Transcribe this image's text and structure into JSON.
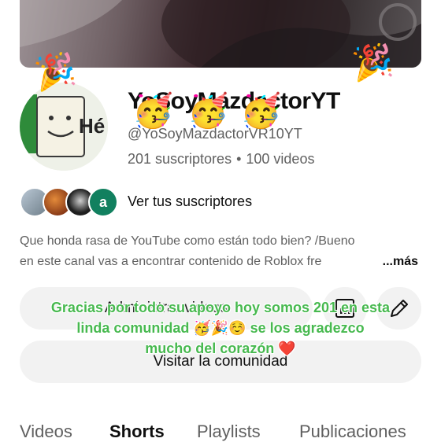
{
  "channel": {
    "name": "YoSoyMazdactorYT",
    "handle": "@YoSoyMazdactorVR10YT",
    "subscribers": "201 suscriptores",
    "videos": "100 videos",
    "avatar_text": "Hé"
  },
  "subscribers_row": {
    "label": "Ver tus suscriptores",
    "last_avatar_letter": "a"
  },
  "description": {
    "line1": "Que honda rasa de YouTube como están todo bien? /Bueno",
    "line2": "en este canal vas a encontrar contenido de Roblox fre",
    "more": "...más"
  },
  "buttons": {
    "manage": "Administrar videos",
    "community": "Visitar la comunidad"
  },
  "icons": {
    "stats": "bar-chart-icon",
    "edit": "pencil-icon"
  },
  "tabs": [
    {
      "label": "Videos"
    },
    {
      "label": "Shorts"
    },
    {
      "label": "Playlists"
    },
    {
      "label": "Publicaciones"
    }
  ],
  "overlay": {
    "line1": "Gracias por todo su apoyo hoy somos 201 en esta",
    "line2": "linda comunidad 🥳🎉☺️ se los agradezco",
    "line3": "mucho del corazón ❤️",
    "color": "#47b94f"
  },
  "stickers": {
    "popper": "🎉",
    "party_face": "🥳"
  },
  "colors": {
    "text_primary": "#0f0f0f",
    "text_secondary": "#606060",
    "button_bg": "#f2f2f2"
  }
}
